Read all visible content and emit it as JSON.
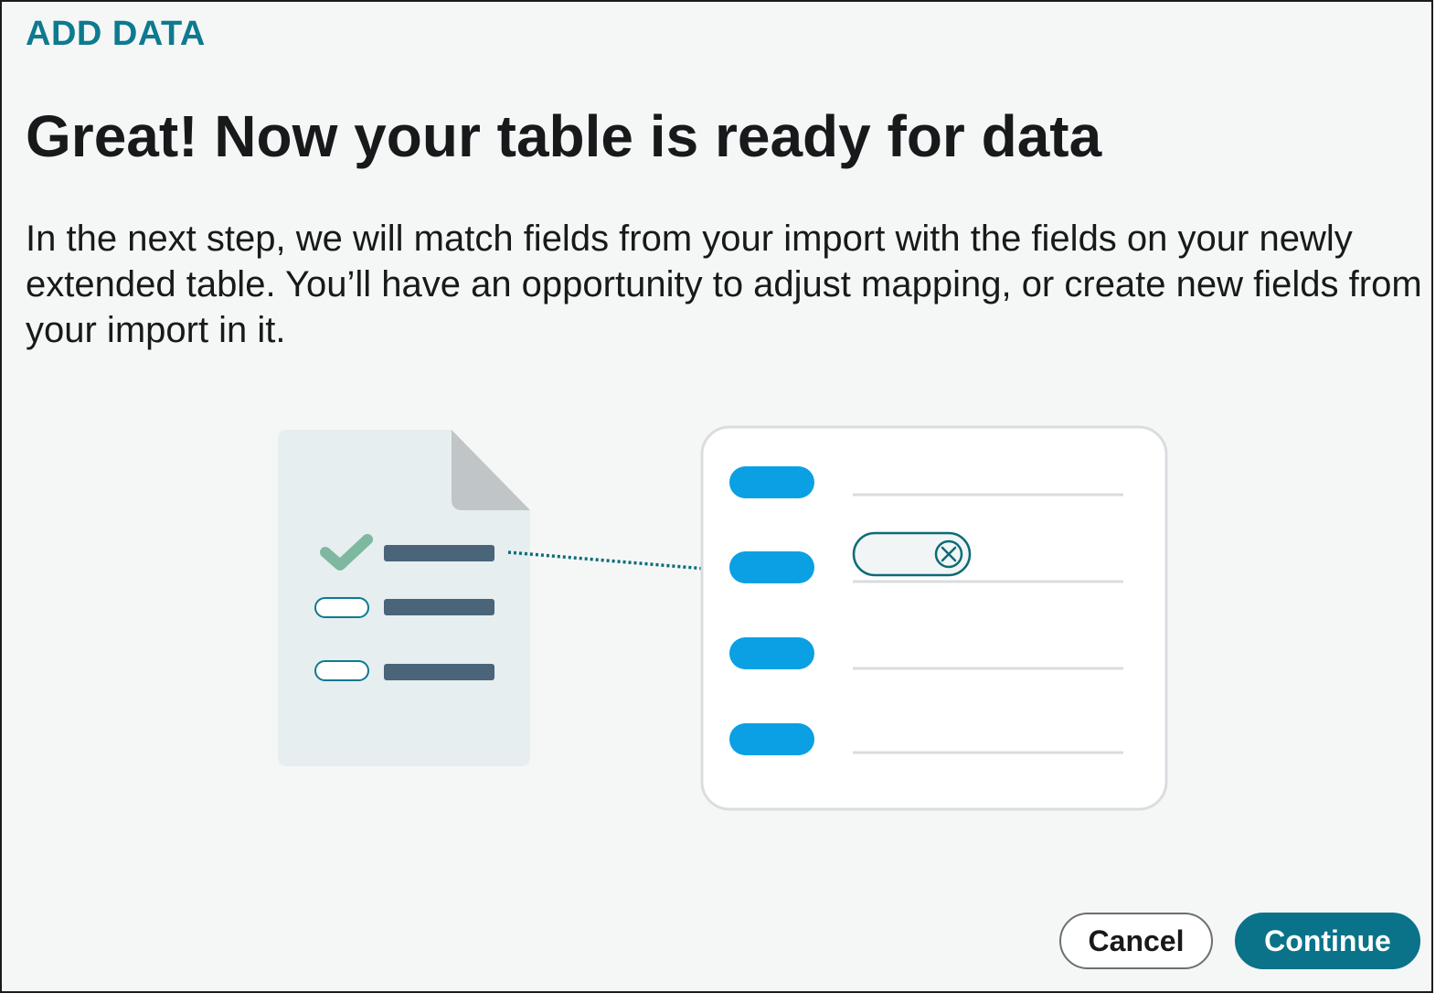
{
  "dialog": {
    "eyebrow": "ADD DATA",
    "title": "Great! Now your table is ready for data",
    "description": "In the next step, we will match fields from your import with the fields on your newly extended table. You’ll have an opportunity to adjust mapping, or create new fields from your import in it."
  },
  "actions": {
    "cancel_label": "Cancel",
    "continue_label": "Continue"
  },
  "illustration": {
    "icons": [
      "document-icon",
      "checkmark-icon",
      "table-card-icon",
      "remove-mapping-icon"
    ]
  },
  "colors": {
    "accent": "#0a7389",
    "eyebrow": "#0d7a8f",
    "field_pill": "#0aa0e3",
    "document_line": "#4a6479",
    "checkmark": "#7fb8a1",
    "dialog_background": "#f5f7f7"
  }
}
